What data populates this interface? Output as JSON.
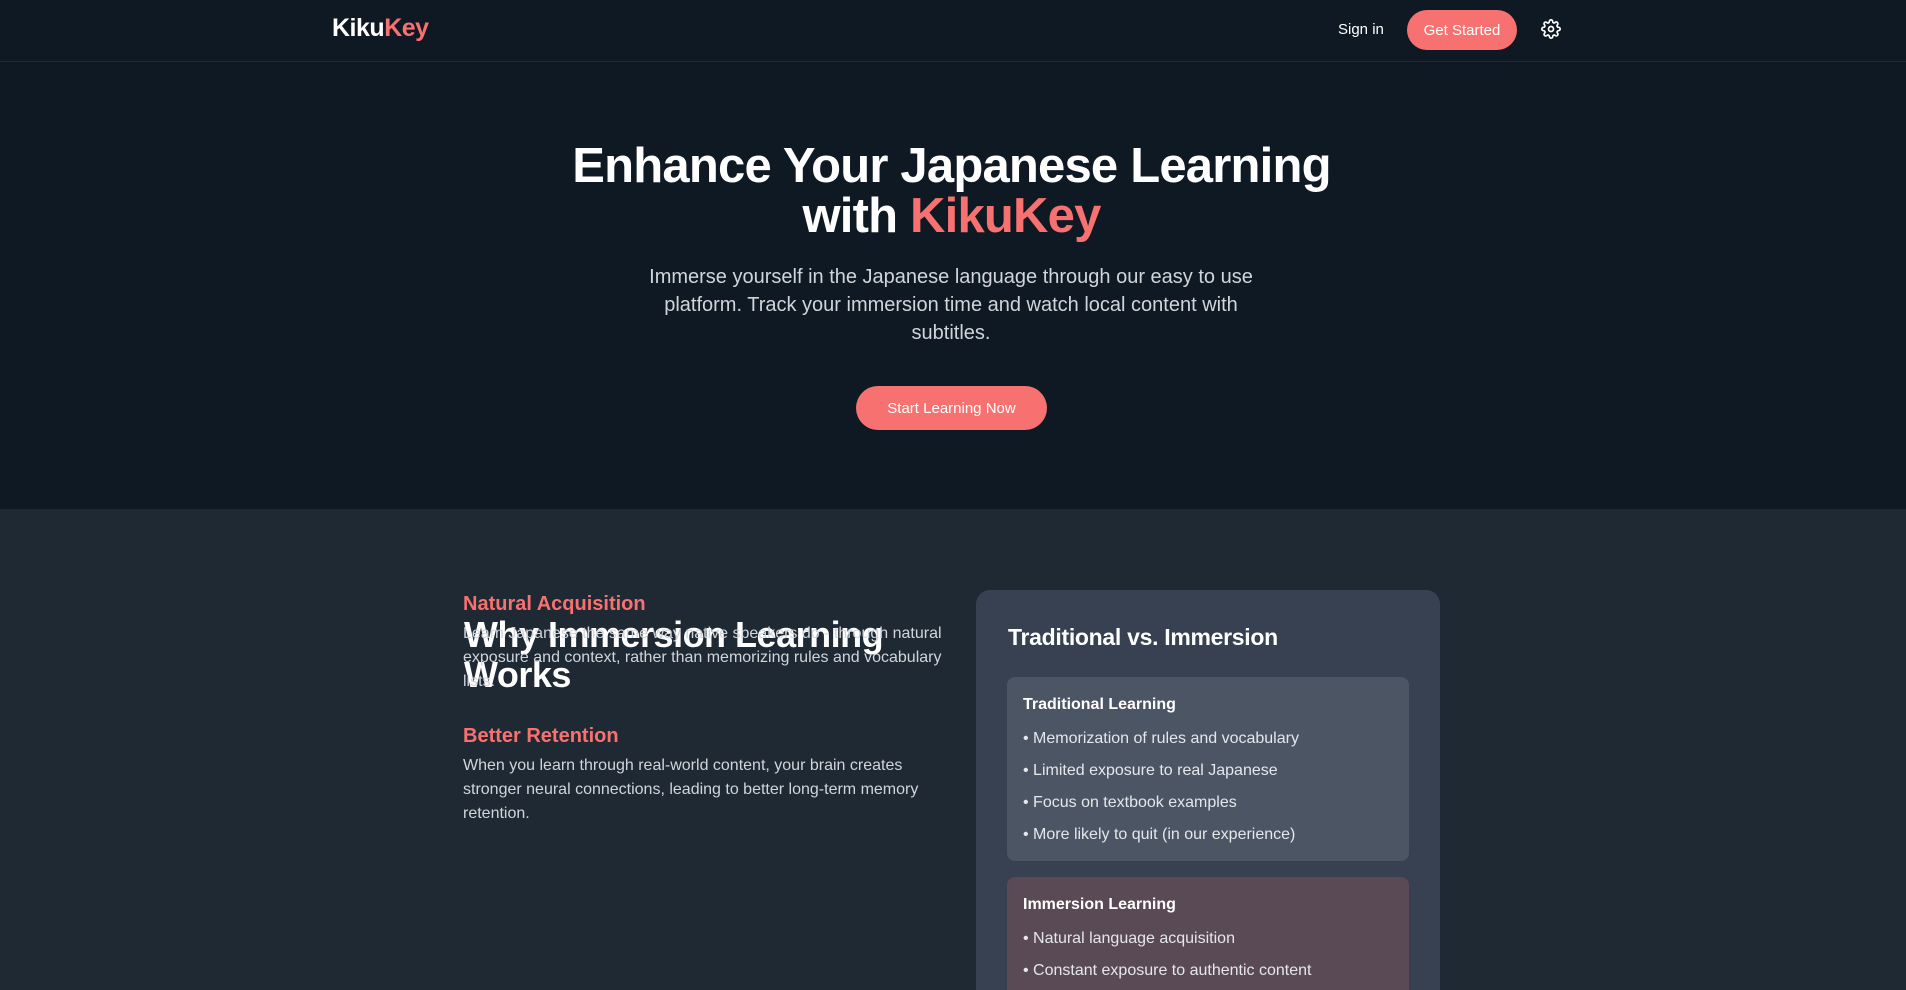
{
  "nav": {
    "logo_part1": "Kiku",
    "logo_part2": "Key",
    "signin_label": "Sign in",
    "get_started_label": "Get Started",
    "settings_icon": "gear-icon"
  },
  "hero": {
    "title_line1": "Enhance Your Japanese Learning",
    "title_with": "with ",
    "title_accent": "KikuKey",
    "subtitle": "Immerse yourself in the Japanese language through our easy to use platform. Track your immersion time and watch local content with subtitles.",
    "cta_label": "Start Learning Now"
  },
  "why": {
    "title": "Why Immersion Learning Works",
    "features": [
      {
        "title": "Natural Acquisition",
        "body": "Learn Japanese the same way native speakers do - through natural exposure and context, rather than memorizing rules and vocabulary lists."
      },
      {
        "title": "Better Retention",
        "body": "When you learn through real-world content, your brain creates stronger neural connections, leading to better long-term memory retention."
      }
    ]
  },
  "compare": {
    "title": "Traditional vs. Immersion",
    "traditional": {
      "title": "Traditional Learning",
      "items": [
        "• Memorization of rules and vocabulary",
        "• Limited exposure to real Japanese",
        "• Focus on textbook examples",
        "• More likely to quit (in our experience)"
      ]
    },
    "immersion": {
      "title": "Immersion Learning",
      "items": [
        "• Natural language acquisition",
        "• Constant exposure to authentic content"
      ]
    }
  },
  "colors": {
    "accent": "#f87171",
    "background": "#0f1923",
    "section_background": "#1e2933",
    "card": "#374151"
  }
}
